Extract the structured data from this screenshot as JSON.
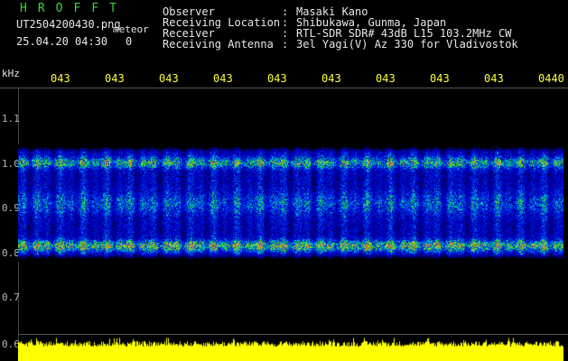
{
  "header": {
    "brand": "HROFFT",
    "filename": "UT2504200430.png",
    "meteor_label": "meteor",
    "datetime": "25.04.20 04:30",
    "meteor_count": "0"
  },
  "info": [
    {
      "label": "Observer",
      "value": "Masaki Kano"
    },
    {
      "label": "Receiving Location",
      "value": "Shibukawa, Gunma, Japan"
    },
    {
      "label": "Receiver",
      "value": "RTL-SDR SDR# 43dB L15 103.2MHz CW"
    },
    {
      "label": "Receiving Antenna",
      "value": "3el Yagi(V) Az 330 for Vladivostok"
    }
  ],
  "axis": {
    "unit": "kHz",
    "time_ticks": [
      "043",
      "043",
      "043",
      "043",
      "043",
      "043",
      "043",
      "043",
      "043",
      "0440"
    ],
    "freq_ticks": [
      "1.1",
      "1.0",
      "0.9",
      "0.8",
      "0.7",
      "0.6"
    ]
  },
  "colors": {
    "brand": "#37d637",
    "ticks": "#ffff3a",
    "psd": "#ffff00",
    "background": "#000000"
  }
}
